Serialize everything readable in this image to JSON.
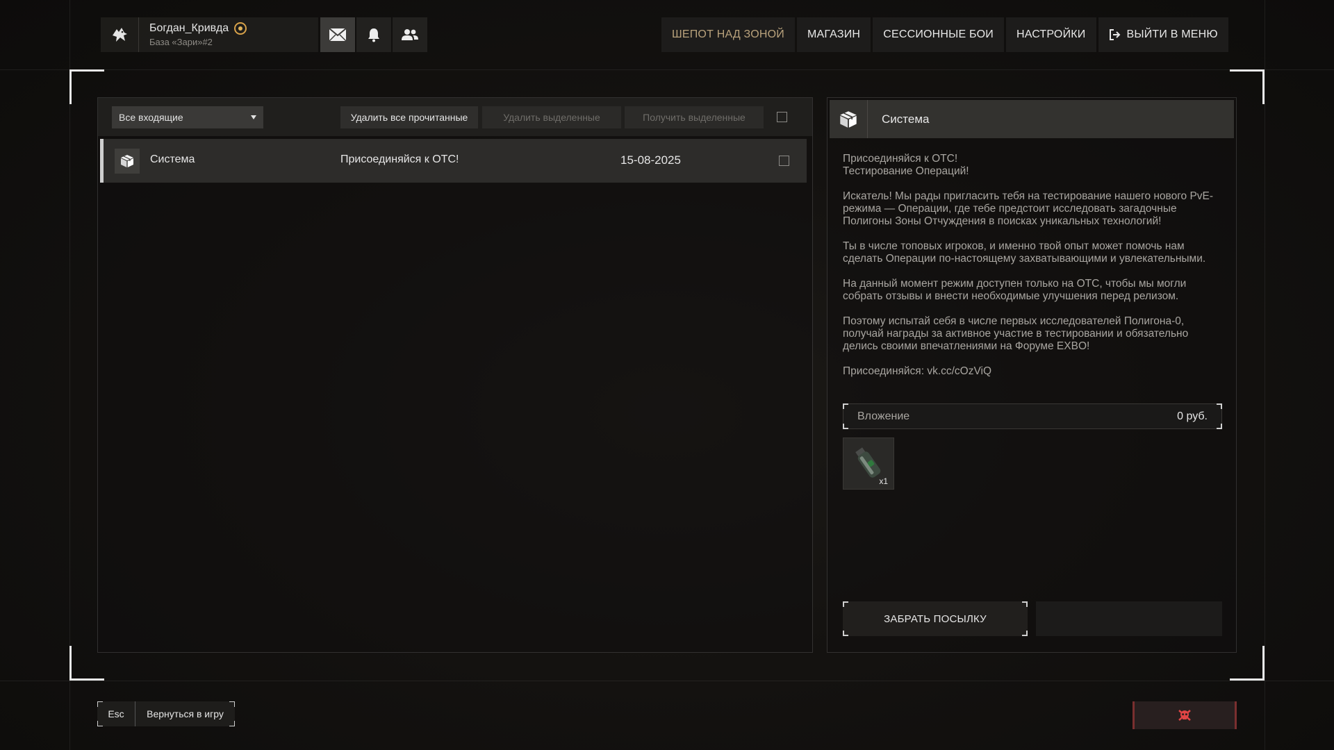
{
  "profile": {
    "username": "Богдан_Кривда",
    "clan": "База «Зари»#2"
  },
  "header_icons": [
    "mail-icon",
    "bell-icon",
    "friends-icon"
  ],
  "nav": {
    "items": [
      {
        "label": "ШЕПОТ НАД ЗОНОЙ",
        "active": true
      },
      {
        "label": "МАГАЗИН"
      },
      {
        "label": "СЕССИОННЫЕ БОИ"
      },
      {
        "label": "НАСТРОЙКИ"
      },
      {
        "label": "ВЫЙТИ В МЕНЮ",
        "icon": "exit-icon"
      }
    ]
  },
  "mailbox": {
    "filter_selected": "Все входящие",
    "buttons": {
      "delete_read": "Удалить все прочитанные",
      "delete_selected": "Удалить выделенные",
      "receive_selected": "Получить выделенные"
    },
    "messages": [
      {
        "sender": "Система",
        "subject": "Присоединяйся к ОТС!",
        "date": "15-08-2025"
      }
    ]
  },
  "detail": {
    "sender": "Система",
    "title_lines": [
      "Присоединяйся к ОТС!",
      "Тестирование Операций!"
    ],
    "paragraphs": [
      "Искатель! Мы рады пригласить тебя на тестирование нашего нового PvE-режима — Операции, где тебе предстоит исследовать загадочные Полигоны Зоны Отчуждения в поисках уникальных технологий!",
      "Ты в числе топовых игроков, и именно твой опыт может помочь нам сделать Операции по-настоящему захватывающими и увлекательными.",
      "На данный момент режим доступен только на ОТС, чтобы мы могли собрать отзывы и внести необходимые улучшения перед релизом.",
      "Поэтому испытай себя в числе первых исследователей Полигона-0, получай награды за активное участие в тестировании и обязательно делись своими впечатлениями на Форуме EXBO!",
      "Присоединяйся: vk.cc/cOzViQ"
    ],
    "attachment_label": "Вложение",
    "attachment_value": "0 руб.",
    "attachment_item_qty": "x1",
    "claim_button": "ЗАБРАТЬ ПОСЫЛКУ"
  },
  "footer": {
    "esc_key": "Esc",
    "esc_label": "Вернуться в игру"
  },
  "colors": {
    "accent_gold": "#b9a27c",
    "report_red": "#e04545"
  }
}
